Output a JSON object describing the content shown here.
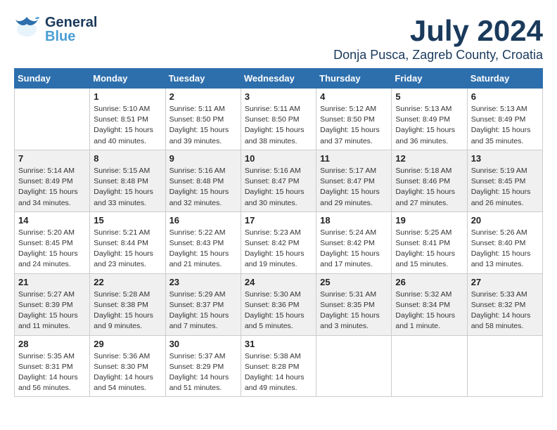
{
  "logo": {
    "line1": "General",
    "line2": "Blue"
  },
  "title": "July 2024",
  "location": "Donja Pusca, Zagreb County, Croatia",
  "days_of_week": [
    "Sunday",
    "Monday",
    "Tuesday",
    "Wednesday",
    "Thursday",
    "Friday",
    "Saturday"
  ],
  "weeks": [
    [
      {
        "day": "",
        "info": ""
      },
      {
        "day": "1",
        "info": "Sunrise: 5:10 AM\nSunset: 8:51 PM\nDaylight: 15 hours\nand 40 minutes."
      },
      {
        "day": "2",
        "info": "Sunrise: 5:11 AM\nSunset: 8:50 PM\nDaylight: 15 hours\nand 39 minutes."
      },
      {
        "day": "3",
        "info": "Sunrise: 5:11 AM\nSunset: 8:50 PM\nDaylight: 15 hours\nand 38 minutes."
      },
      {
        "day": "4",
        "info": "Sunrise: 5:12 AM\nSunset: 8:50 PM\nDaylight: 15 hours\nand 37 minutes."
      },
      {
        "day": "5",
        "info": "Sunrise: 5:13 AM\nSunset: 8:49 PM\nDaylight: 15 hours\nand 36 minutes."
      },
      {
        "day": "6",
        "info": "Sunrise: 5:13 AM\nSunset: 8:49 PM\nDaylight: 15 hours\nand 35 minutes."
      }
    ],
    [
      {
        "day": "7",
        "info": "Sunrise: 5:14 AM\nSunset: 8:49 PM\nDaylight: 15 hours\nand 34 minutes."
      },
      {
        "day": "8",
        "info": "Sunrise: 5:15 AM\nSunset: 8:48 PM\nDaylight: 15 hours\nand 33 minutes."
      },
      {
        "day": "9",
        "info": "Sunrise: 5:16 AM\nSunset: 8:48 PM\nDaylight: 15 hours\nand 32 minutes."
      },
      {
        "day": "10",
        "info": "Sunrise: 5:16 AM\nSunset: 8:47 PM\nDaylight: 15 hours\nand 30 minutes."
      },
      {
        "day": "11",
        "info": "Sunrise: 5:17 AM\nSunset: 8:47 PM\nDaylight: 15 hours\nand 29 minutes."
      },
      {
        "day": "12",
        "info": "Sunrise: 5:18 AM\nSunset: 8:46 PM\nDaylight: 15 hours\nand 27 minutes."
      },
      {
        "day": "13",
        "info": "Sunrise: 5:19 AM\nSunset: 8:45 PM\nDaylight: 15 hours\nand 26 minutes."
      }
    ],
    [
      {
        "day": "14",
        "info": "Sunrise: 5:20 AM\nSunset: 8:45 PM\nDaylight: 15 hours\nand 24 minutes."
      },
      {
        "day": "15",
        "info": "Sunrise: 5:21 AM\nSunset: 8:44 PM\nDaylight: 15 hours\nand 23 minutes."
      },
      {
        "day": "16",
        "info": "Sunrise: 5:22 AM\nSunset: 8:43 PM\nDaylight: 15 hours\nand 21 minutes."
      },
      {
        "day": "17",
        "info": "Sunrise: 5:23 AM\nSunset: 8:42 PM\nDaylight: 15 hours\nand 19 minutes."
      },
      {
        "day": "18",
        "info": "Sunrise: 5:24 AM\nSunset: 8:42 PM\nDaylight: 15 hours\nand 17 minutes."
      },
      {
        "day": "19",
        "info": "Sunrise: 5:25 AM\nSunset: 8:41 PM\nDaylight: 15 hours\nand 15 minutes."
      },
      {
        "day": "20",
        "info": "Sunrise: 5:26 AM\nSunset: 8:40 PM\nDaylight: 15 hours\nand 13 minutes."
      }
    ],
    [
      {
        "day": "21",
        "info": "Sunrise: 5:27 AM\nSunset: 8:39 PM\nDaylight: 15 hours\nand 11 minutes."
      },
      {
        "day": "22",
        "info": "Sunrise: 5:28 AM\nSunset: 8:38 PM\nDaylight: 15 hours\nand 9 minutes."
      },
      {
        "day": "23",
        "info": "Sunrise: 5:29 AM\nSunset: 8:37 PM\nDaylight: 15 hours\nand 7 minutes."
      },
      {
        "day": "24",
        "info": "Sunrise: 5:30 AM\nSunset: 8:36 PM\nDaylight: 15 hours\nand 5 minutes."
      },
      {
        "day": "25",
        "info": "Sunrise: 5:31 AM\nSunset: 8:35 PM\nDaylight: 15 hours\nand 3 minutes."
      },
      {
        "day": "26",
        "info": "Sunrise: 5:32 AM\nSunset: 8:34 PM\nDaylight: 15 hours\nand 1 minute."
      },
      {
        "day": "27",
        "info": "Sunrise: 5:33 AM\nSunset: 8:32 PM\nDaylight: 14 hours\nand 58 minutes."
      }
    ],
    [
      {
        "day": "28",
        "info": "Sunrise: 5:35 AM\nSunset: 8:31 PM\nDaylight: 14 hours\nand 56 minutes."
      },
      {
        "day": "29",
        "info": "Sunrise: 5:36 AM\nSunset: 8:30 PM\nDaylight: 14 hours\nand 54 minutes."
      },
      {
        "day": "30",
        "info": "Sunrise: 5:37 AM\nSunset: 8:29 PM\nDaylight: 14 hours\nand 51 minutes."
      },
      {
        "day": "31",
        "info": "Sunrise: 5:38 AM\nSunset: 8:28 PM\nDaylight: 14 hours\nand 49 minutes."
      },
      {
        "day": "",
        "info": ""
      },
      {
        "day": "",
        "info": ""
      },
      {
        "day": "",
        "info": ""
      }
    ]
  ]
}
